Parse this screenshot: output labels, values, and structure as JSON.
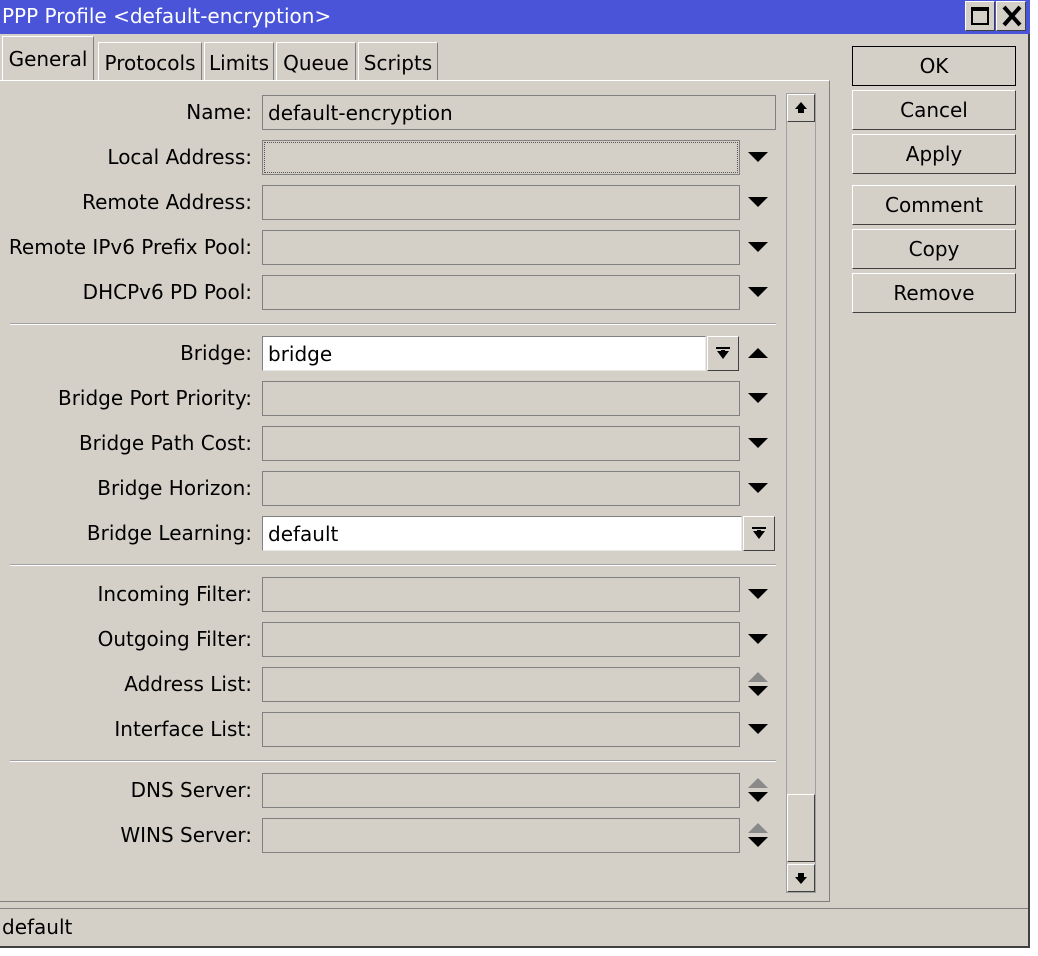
{
  "window": {
    "title": "PPP Profile <default-encryption>"
  },
  "tabs": [
    {
      "label": "General",
      "active": true
    },
    {
      "label": "Protocols"
    },
    {
      "label": "Limits"
    },
    {
      "label": "Queue"
    },
    {
      "label": "Scripts"
    }
  ],
  "fields": {
    "name": {
      "label": "Name:",
      "value": "default-encryption"
    },
    "local_address": {
      "label": "Local Address:",
      "value": ""
    },
    "remote_address": {
      "label": "Remote Address:",
      "value": ""
    },
    "remote_ipv6_prefix_pool": {
      "label": "Remote IPv6 Prefix Pool:",
      "value": ""
    },
    "dhcpv6_pd_pool": {
      "label": "DHCPv6 PD Pool:",
      "value": ""
    },
    "bridge": {
      "label": "Bridge:",
      "value": "bridge"
    },
    "bridge_port_priority": {
      "label": "Bridge Port Priority:",
      "value": ""
    },
    "bridge_path_cost": {
      "label": "Bridge Path Cost:",
      "value": ""
    },
    "bridge_horizon": {
      "label": "Bridge Horizon:",
      "value": ""
    },
    "bridge_learning": {
      "label": "Bridge Learning:",
      "value": "default"
    },
    "incoming_filter": {
      "label": "Incoming Filter:",
      "value": ""
    },
    "outgoing_filter": {
      "label": "Outgoing Filter:",
      "value": ""
    },
    "address_list": {
      "label": "Address List:",
      "value": ""
    },
    "interface_list": {
      "label": "Interface List:",
      "value": ""
    },
    "dns_server": {
      "label": "DNS Server:",
      "value": ""
    },
    "wins_server": {
      "label": "WINS Server:",
      "value": ""
    }
  },
  "buttons": {
    "ok": "OK",
    "cancel": "Cancel",
    "apply": "Apply",
    "comment": "Comment",
    "copy": "Copy",
    "remove": "Remove"
  },
  "status": {
    "text": "default"
  },
  "colors": {
    "titlebar": "#4a54d8",
    "face": "#d4d0c8"
  },
  "icons": {
    "maximize": "maximize-icon",
    "close": "close-icon",
    "dropdown": "triangle-down-icon",
    "collapse": "triangle-up-icon",
    "spinner": "up-down-icon",
    "select": "dropdown-select-icon"
  }
}
